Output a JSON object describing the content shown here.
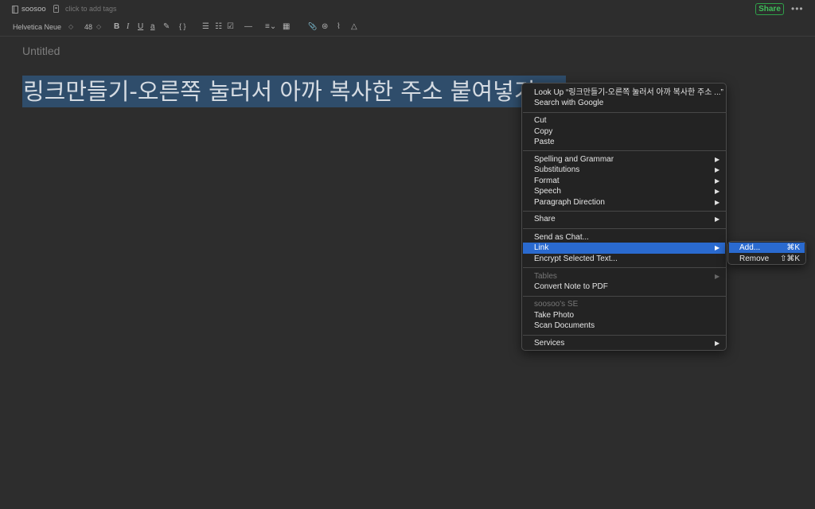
{
  "topbar": {
    "notebook_icon": "notebook-icon",
    "notebook_name": "soosoo",
    "tag_icon": "tag-icon",
    "tags_placeholder": "click to add tags",
    "share_label": "Share",
    "share_color": "#3fbf5a",
    "more_label": "•••"
  },
  "toolbar": {
    "font_name": "Helvetica Neue",
    "font_size": "48",
    "font_arrows": "◇",
    "bold": "B",
    "italic": "I",
    "underline": "U",
    "text_color": "a",
    "highlight": "✎",
    "code": "{ }",
    "bullet_list": "☰",
    "numbered_list": "☷",
    "checklist": "☑",
    "horizontal_rule": "—",
    "align": "≡⌄",
    "table": "▦",
    "attach": "📎",
    "link": "⊛",
    "clip": "⌇",
    "drive": "△"
  },
  "editor": {
    "title_placeholder": "Untitled",
    "selected_text": "링크만들기-오른쪽 눌러서 아까 복사한 주소 붙여넣기",
    "selection_color": "#2f4d6b"
  },
  "context_menu": {
    "lookup": "Look Up “링크만들기-오른쪽 눌러서 아까 복사한 주소 ...”",
    "search_google": "Search with Google",
    "cut": "Cut",
    "copy": "Copy",
    "paste": "Paste",
    "spelling": "Spelling and Grammar",
    "substitutions": "Substitutions",
    "format": "Format",
    "speech": "Speech",
    "paragraph_direction": "Paragraph Direction",
    "share": "Share",
    "send_as_chat": "Send as Chat...",
    "link": "Link",
    "encrypt": "Encrypt Selected Text...",
    "tables": "Tables",
    "convert_pdf": "Convert Note to PDF",
    "device_header": "soosoo's SE",
    "take_photo": "Take Photo",
    "scan_documents": "Scan Documents",
    "services": "Services",
    "submenu_arrow": "▶",
    "highlight_color": "#2a6acf"
  },
  "link_submenu": {
    "add": "Add...",
    "add_shortcut": "⌘K",
    "remove": "Remove",
    "remove_shortcut": "⇧⌘K"
  }
}
